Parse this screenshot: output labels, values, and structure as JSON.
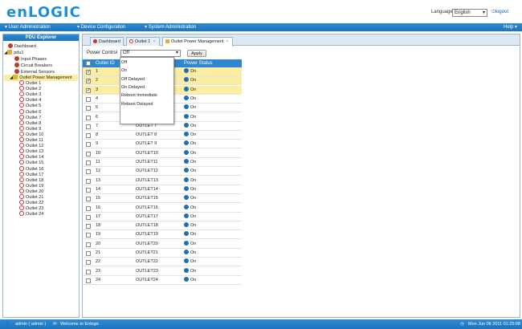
{
  "header": {
    "logo": "enLOGIC",
    "language_label": "Language",
    "language_value": "English",
    "logout_label": "logout"
  },
  "menubar": {
    "items": [
      "User Administration",
      "Device Configuration",
      "System Administration"
    ],
    "help": "Help"
  },
  "sidebar": {
    "title": "PDU Explorer",
    "dashboard": "Dashboard",
    "pdu": "pdu1",
    "children": [
      "Input Phases",
      "Circuit Breakers",
      "External Sensors",
      "Outlet Power Management"
    ],
    "outlets": [
      "Outlet 1",
      "Outlet 2",
      "Outlet 3",
      "Outlet 4",
      "Outlet 5",
      "Outlet 6",
      "Outlet 7",
      "Outlet 8",
      "Outlet 9",
      "Outlet 10",
      "Outlet 11",
      "Outlet 12",
      "Outlet 13",
      "Outlet 14",
      "Outlet 15",
      "Outlet 16",
      "Outlet 17",
      "Outlet 18",
      "Outlet 19",
      "Outlet 20",
      "Outlet 21",
      "Outlet 22",
      "Outlet 23",
      "Outlet 24"
    ]
  },
  "tabs": [
    "Dashboard",
    "Outlet 1",
    "Outlet Power Management"
  ],
  "toolbar": {
    "power_control_label": "Power Control",
    "power_control_value": "Off",
    "apply_label": "Apply"
  },
  "table": {
    "headers": [
      "Outlet ID",
      "",
      "Power Status"
    ],
    "rows": [
      {
        "id": "1",
        "name": "",
        "status": "On",
        "selected": true
      },
      {
        "id": "2",
        "name": "",
        "status": "On",
        "selected": true
      },
      {
        "id": "3",
        "name": "",
        "status": "On",
        "selected": true
      },
      {
        "id": "4",
        "name": "",
        "status": "On",
        "selected": false
      },
      {
        "id": "5",
        "name": "",
        "status": "On",
        "selected": false
      },
      {
        "id": "6",
        "name": "",
        "status": "On",
        "selected": false
      },
      {
        "id": "7",
        "name": "OUTLET 7",
        "status": "On",
        "selected": false
      },
      {
        "id": "8",
        "name": "OUTLET 8",
        "status": "On",
        "selected": false
      },
      {
        "id": "9",
        "name": "OUTLET 9",
        "status": "On",
        "selected": false
      },
      {
        "id": "10",
        "name": "OUTLET10",
        "status": "On",
        "selected": false
      },
      {
        "id": "11",
        "name": "OUTLET11",
        "status": "On",
        "selected": false
      },
      {
        "id": "12",
        "name": "OUTLET12",
        "status": "On",
        "selected": false
      },
      {
        "id": "13",
        "name": "OUTLET13",
        "status": "On",
        "selected": false
      },
      {
        "id": "14",
        "name": "OUTLET14",
        "status": "On",
        "selected": false
      },
      {
        "id": "15",
        "name": "OUTLET15",
        "status": "On",
        "selected": false
      },
      {
        "id": "16",
        "name": "OUTLET16",
        "status": "On",
        "selected": false
      },
      {
        "id": "17",
        "name": "OUTLET17",
        "status": "On",
        "selected": false
      },
      {
        "id": "18",
        "name": "OUTLET18",
        "status": "On",
        "selected": false
      },
      {
        "id": "19",
        "name": "OUTLET19",
        "status": "On",
        "selected": false
      },
      {
        "id": "20",
        "name": "OUTLET20",
        "status": "On",
        "selected": false
      },
      {
        "id": "21",
        "name": "OUTLET21",
        "status": "On",
        "selected": false
      },
      {
        "id": "22",
        "name": "OUTLET22",
        "status": "On",
        "selected": false
      },
      {
        "id": "23",
        "name": "OUTLET23",
        "status": "On",
        "selected": false
      },
      {
        "id": "24",
        "name": "OUTLET24",
        "status": "On",
        "selected": false
      }
    ]
  },
  "dropdown": {
    "options": [
      "Off",
      "On",
      "Off Delayed",
      "On Delayed",
      "Reboot Immediate",
      "Reboot Delayed"
    ]
  },
  "statusbar": {
    "user": "admin ( admin )",
    "welcome": "Welcome to Enlogic",
    "datetime": "Mon Jun 06 2011 01:25:08"
  },
  "colors": {
    "accent": "#1f74bd",
    "selected_row": "#fbeea2",
    "status_dot": "#1f6fb5"
  }
}
